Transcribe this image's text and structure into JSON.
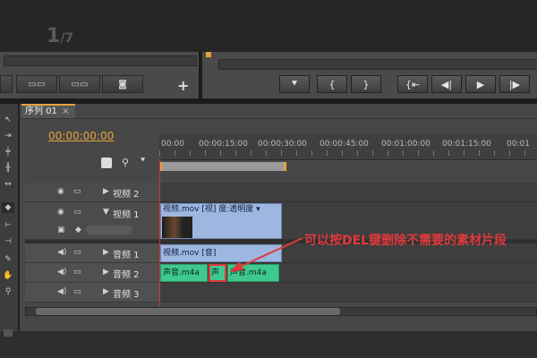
{
  "monitor": {
    "big_label": "1",
    "big_label_small": "/7"
  },
  "left_monitor_buttons": [
    {
      "icon": "lift-icon"
    },
    {
      "icon": "overlay-icon"
    },
    {
      "icon": "export-frame-icon"
    }
  ],
  "add_button": "+",
  "transport_buttons": [
    {
      "icon": "marker-icon",
      "glyph": "⯆"
    },
    {
      "icon": "mark-in-icon",
      "glyph": "{"
    },
    {
      "icon": "mark-out-icon",
      "glyph": "}"
    },
    {
      "icon": "go-to-in-icon",
      "glyph": "{⇤"
    },
    {
      "icon": "step-back-icon",
      "glyph": "◀|"
    },
    {
      "icon": "play-icon",
      "glyph": "▶"
    },
    {
      "icon": "step-forward-icon",
      "glyph": "|▶"
    }
  ],
  "timeline": {
    "tab_label": "序列 01",
    "tab_close": "×",
    "timecode": "00:00:00:00",
    "ruler_ticks": [
      "00:00",
      "00:00:15:00",
      "00:00:30:00",
      "00:00:45:00",
      "00:01:00:00",
      "00:01:15:00",
      "00:01"
    ],
    "tracks": [
      {
        "name": "视频 2",
        "kind": "video"
      },
      {
        "name": "视频 1",
        "kind": "video"
      },
      {
        "name": "音频 1",
        "kind": "audio"
      },
      {
        "name": "音频 2",
        "kind": "audio"
      },
      {
        "name": "音频 3",
        "kind": "audio"
      }
    ],
    "clips": {
      "video1_label": "视频.mov [视] 度:透明度 ▾",
      "audio1_label": "视频.mov [音]",
      "audio2_a": "声音.m4a",
      "audio2_b": "声",
      "audio2_c": "声音.m4a"
    }
  },
  "annotation": {
    "text": "可以按DEL键删除不需要的素材片段",
    "color": "#e0393c"
  },
  "colors": {
    "accent": "#e6a23c",
    "video_clip": "#9db7e0",
    "audio_clip": "#3fc98e",
    "playhead": "#e03030"
  }
}
